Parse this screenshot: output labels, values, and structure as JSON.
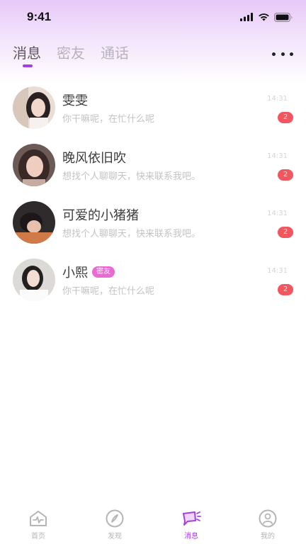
{
  "status_bar": {
    "time": "9:41",
    "icons": [
      "signal-icon",
      "wifi-icon",
      "battery-icon"
    ]
  },
  "tabs": [
    {
      "label": "消息",
      "active": true
    },
    {
      "label": "密友",
      "active": false
    },
    {
      "label": "通话",
      "active": false
    }
  ],
  "more_icon": "more-horizontal-icon",
  "conversations": [
    {
      "name": "雯雯",
      "tag": "",
      "preview": "你干嘛呢，在忙什么呢",
      "time": "14:31",
      "badge": "2"
    },
    {
      "name": "晚风依旧吹",
      "tag": "",
      "preview": "想找个人聊聊天，快来联系我吧。",
      "time": "14:31",
      "badge": "2"
    },
    {
      "name": "可爱的小猪猪",
      "tag": "",
      "preview": "想找个人聊聊天，快来联系我吧。",
      "time": "14:31",
      "badge": "2"
    },
    {
      "name": "小熙",
      "tag": "密友",
      "preview": "你干嘛呢，在忙什么呢",
      "time": "14:31",
      "badge": "2"
    }
  ],
  "bottom_nav": [
    {
      "label": "首页",
      "icon": "home-icon",
      "active": false
    },
    {
      "label": "发现",
      "icon": "compass-icon",
      "active": false
    },
    {
      "label": "消息",
      "icon": "message-icon",
      "active": true
    },
    {
      "label": "我的",
      "icon": "profile-icon",
      "active": false
    }
  ],
  "colors": {
    "accent": "#a53fe0",
    "badge": "#f2565e",
    "tag": "#e96ad2",
    "header_gradient_top": "#e7c8f6"
  }
}
